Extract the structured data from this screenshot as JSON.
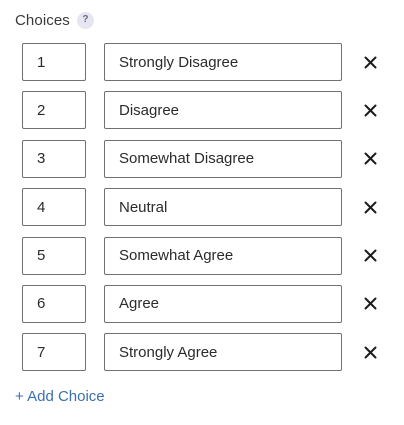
{
  "header": {
    "title": "Choices",
    "help_badge": "?"
  },
  "choices": [
    {
      "value": "1",
      "label": "Strongly Disagree"
    },
    {
      "value": "2",
      "label": "Disagree"
    },
    {
      "value": "3",
      "label": "Somewhat Disagree"
    },
    {
      "value": "4",
      "label": "Neutral"
    },
    {
      "value": "5",
      "label": "Somewhat Agree"
    },
    {
      "value": "6",
      "label": "Agree"
    },
    {
      "value": "7",
      "label": "Strongly Agree"
    }
  ],
  "remove_icon": "close-icon",
  "add_choice_label": "+ Add Choice",
  "colors": {
    "link": "#3b6fb0",
    "border": "#707070",
    "badge_bg": "#e6e6f0"
  }
}
